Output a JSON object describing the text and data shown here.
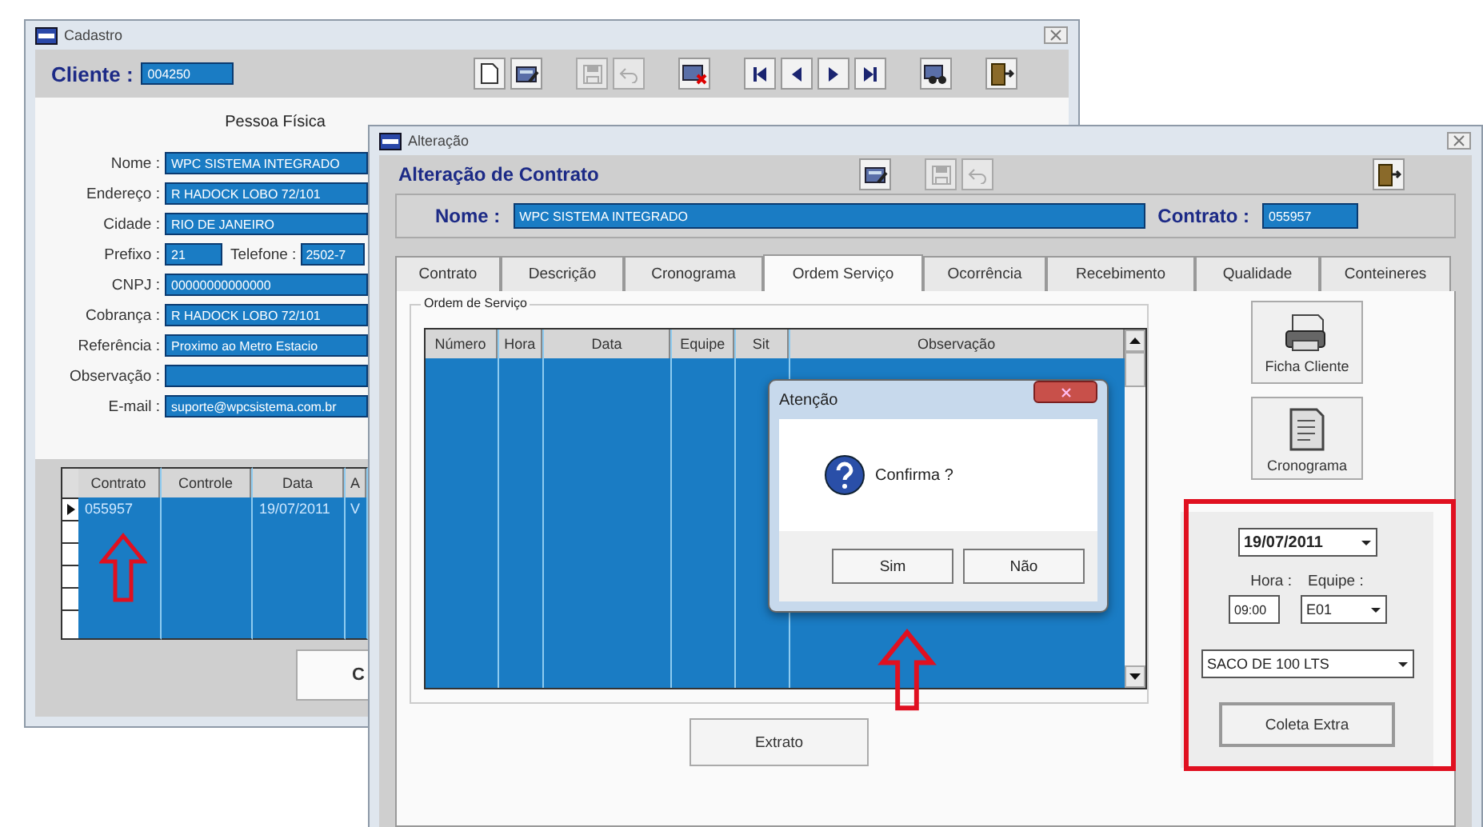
{
  "cadastro": {
    "title": "Cadastro",
    "cliente_label": "Cliente :",
    "cliente": "004250",
    "toolbar_groups": [
      {
        "buttons": [
          {
            "kind": "new",
            "disabled": false
          },
          {
            "kind": "edit",
            "disabled": false
          }
        ]
      },
      {
        "buttons": [
          {
            "kind": "save",
            "disabled": true
          },
          {
            "kind": "undo",
            "disabled": true
          }
        ]
      },
      {
        "buttons": [
          {
            "kind": "delete",
            "disabled": false
          }
        ]
      },
      {
        "buttons": [
          {
            "kind": "first",
            "disabled": false
          },
          {
            "kind": "prev",
            "disabled": false
          },
          {
            "kind": "next",
            "disabled": false
          },
          {
            "kind": "last",
            "disabled": false
          }
        ]
      },
      {
        "buttons": [
          {
            "kind": "search",
            "disabled": false
          }
        ]
      },
      {
        "buttons": [
          {
            "kind": "exit",
            "disabled": false
          }
        ]
      }
    ],
    "section": "Pessoa Física",
    "fields": [
      {
        "kind": "single",
        "label": "Nome :",
        "value": "WPC SISTEMA INTEGRADO"
      },
      {
        "kind": "single",
        "label": "Endereço :",
        "value": "R HADOCK LOBO 72/101"
      },
      {
        "kind": "single",
        "label": "Cidade :",
        "value": "RIO DE JANEIRO"
      },
      {
        "kind": "pair",
        "label": "Prefixo :",
        "value": "21",
        "second_label": "Telefone :",
        "second_value": "2502-7"
      },
      {
        "kind": "single",
        "label": "CNPJ :",
        "value": "00000000000000"
      },
      {
        "kind": "single",
        "label": "Cobrança :",
        "value": "R HADOCK LOBO 72/101"
      },
      {
        "kind": "single",
        "label": "Referência :",
        "value": "Proximo ao Metro Estacio"
      },
      {
        "kind": "single",
        "label": "Observação :"
      },
      {
        "kind": "single",
        "label": "E-mail :",
        "value": "suporte@wpcsistema.com.br"
      }
    ],
    "table": {
      "columns": [
        "Contrato",
        "Controle",
        "Data",
        "A"
      ],
      "rows": [
        {
          "current": true,
          "contrato": "055957",
          "data": "19/07/2011",
          "column_4": "V"
        }
      ]
    },
    "button": "C"
  },
  "alteracao": {
    "title": "Alteração",
    "heading": "Alteração  de Contrato",
    "toolbar_groups": [
      {
        "buttons": [
          {
            "kind": "edit",
            "disabled": false
          }
        ]
      },
      {
        "buttons": [
          {
            "kind": "save",
            "disabled": true
          },
          {
            "kind": "undo",
            "disabled": true
          }
        ]
      },
      {
        "buttons": [
          {
            "kind": "exit",
            "disabled": false
          }
        ]
      }
    ],
    "nome_label": "Nome :",
    "nome": "WPC SISTEMA INTEGRADO",
    "contrato_label": "Contrato :",
    "contrato": "055957",
    "tabs": [
      {
        "label": "Contrato",
        "selected": false
      },
      {
        "label": "Descrição",
        "selected": false
      },
      {
        "label": "Cronograma",
        "selected": false
      },
      {
        "label": "Ordem Serviço",
        "selected": true
      },
      {
        "label": "Ocorrência",
        "selected": false
      },
      {
        "label": "Recebimento",
        "selected": false
      },
      {
        "label": "Qualidade",
        "selected": false
      },
      {
        "label": "Conteineres",
        "selected": false
      }
    ],
    "group_title": "Ordem de Serviço",
    "columns": [
      "Número",
      "Hora",
      "Data",
      "Equipe",
      "Sit",
      "Observação"
    ],
    "extrato_button": "Extrato",
    "side_buttons": [
      {
        "kind": "printer",
        "label": "Ficha Cliente"
      },
      {
        "kind": "document",
        "label": "Cronograma"
      }
    ],
    "date": "19/07/2011",
    "hora_label": "Hora :",
    "equipe_label": "Equipe :",
    "hora": "09:00",
    "equipe": "E01",
    "item": "SACO DE 100 LTS",
    "coleta_button": "Coleta Extra"
  },
  "dialog": {
    "title": "Atenção",
    "message": "Confirma ?",
    "buttons": [
      "Sim",
      "Não"
    ]
  }
}
